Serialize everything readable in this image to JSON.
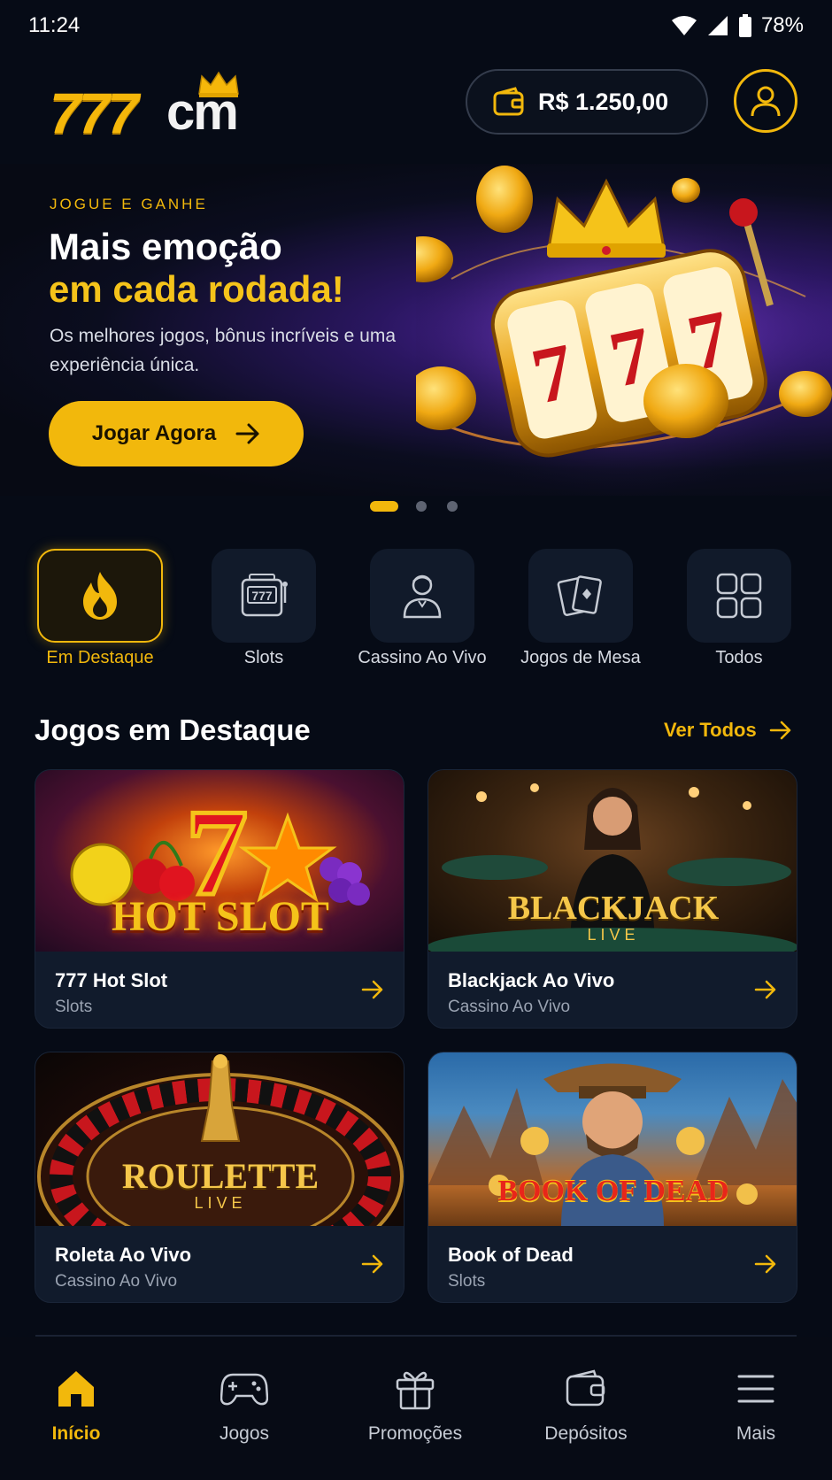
{
  "status_bar": {
    "time": "11:24",
    "battery": "78%"
  },
  "header": {
    "logo_digits": "777",
    "logo_suffix": "cm",
    "balance": "R$ 1.250,00"
  },
  "banner": {
    "eyebrow": "JOGUE E GANHE",
    "headline_line1": "Mais emoção",
    "headline_line2": "em cada rodada!",
    "subtitle": "Os melhores jogos, bônus incríveis e uma experiência única.",
    "cta_label": "Jogar Agora",
    "slides_total": 3,
    "active_slide": 1
  },
  "categories": [
    {
      "label": "Em Destaque",
      "icon": "fire-icon",
      "active": true
    },
    {
      "label": "Slots",
      "icon": "slot-machine-icon",
      "active": false
    },
    {
      "label": "Cassino Ao Vivo",
      "icon": "dealer-icon",
      "active": false
    },
    {
      "label": "Jogos de Mesa",
      "icon": "cards-icon",
      "active": false
    },
    {
      "label": "Todos",
      "icon": "grid-icon",
      "active": false
    }
  ],
  "featured": {
    "title": "Jogos em Destaque",
    "see_all": "Ver Todos",
    "games": [
      {
        "art_text": "HOT SLOT",
        "name": "777 Hot Slot",
        "category": "Slots"
      },
      {
        "art_text": "BLACKJACK",
        "art_sub": "LIVE",
        "name": "Blackjack Ao Vivo",
        "category": "Cassino Ao Vivo"
      },
      {
        "art_text": "ROULETTE",
        "art_sub": "LIVE",
        "name": "Roleta Ao Vivo",
        "category": "Cassino Ao Vivo"
      },
      {
        "art_text": "BOOK OF DEAD",
        "name": "Book of Dead",
        "category": "Slots"
      }
    ]
  },
  "bottom_nav": [
    {
      "label": "Início",
      "icon": "home-icon",
      "active": true
    },
    {
      "label": "Jogos",
      "icon": "gamepad-icon",
      "active": false
    },
    {
      "label": "Promoções",
      "icon": "gift-icon",
      "active": false
    },
    {
      "label": "Depósitos",
      "icon": "wallet-icon",
      "active": false
    },
    {
      "label": "Mais",
      "icon": "menu-icon",
      "active": false
    }
  ],
  "colors": {
    "accent": "#f2b80c",
    "background": "#060b16",
    "card": "#111b2c"
  }
}
